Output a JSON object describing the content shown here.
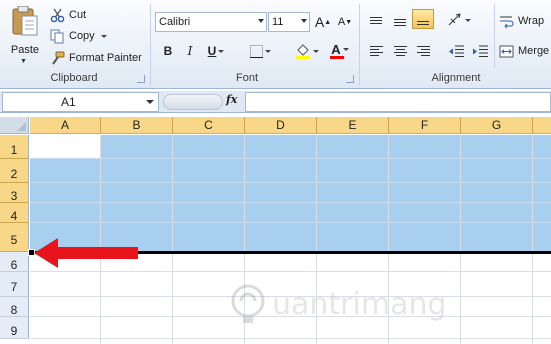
{
  "ribbon": {
    "clipboard": {
      "paste_label": "Paste",
      "cut_label": "Cut",
      "copy_label": "Copy",
      "format_painter_label": "Format Painter",
      "group_label": "Clipboard"
    },
    "font": {
      "font_name": "Calibri",
      "font_size": "11",
      "bold": "B",
      "italic": "I",
      "underline": "U",
      "font_color_letter": "A",
      "grow_font": "A",
      "shrink_font": "A",
      "group_label": "Font"
    },
    "alignment": {
      "wrap_label": "Wrap",
      "merge_label": "Merge",
      "group_label": "Alignment"
    },
    "colors": {
      "font_color_bar": "#ff0000",
      "fill_color_bar": "#ffff00"
    }
  },
  "formula_bar": {
    "name_box": "A1",
    "fx_label": "fx",
    "formula_value": ""
  },
  "sheet": {
    "columns": [
      "A",
      "B",
      "C",
      "D",
      "E",
      "F",
      "G"
    ],
    "rows": [
      "1",
      "2",
      "3",
      "4",
      "5",
      "6",
      "7",
      "8",
      "9"
    ],
    "selected_rows": [
      "1",
      "2",
      "3",
      "4",
      "5"
    ],
    "selection_color": "#a9cfef",
    "header_highlight": "#f8d888"
  },
  "annotation": {
    "arrow_color": "#e8141c"
  },
  "watermark": {
    "text": "uantrimang"
  }
}
